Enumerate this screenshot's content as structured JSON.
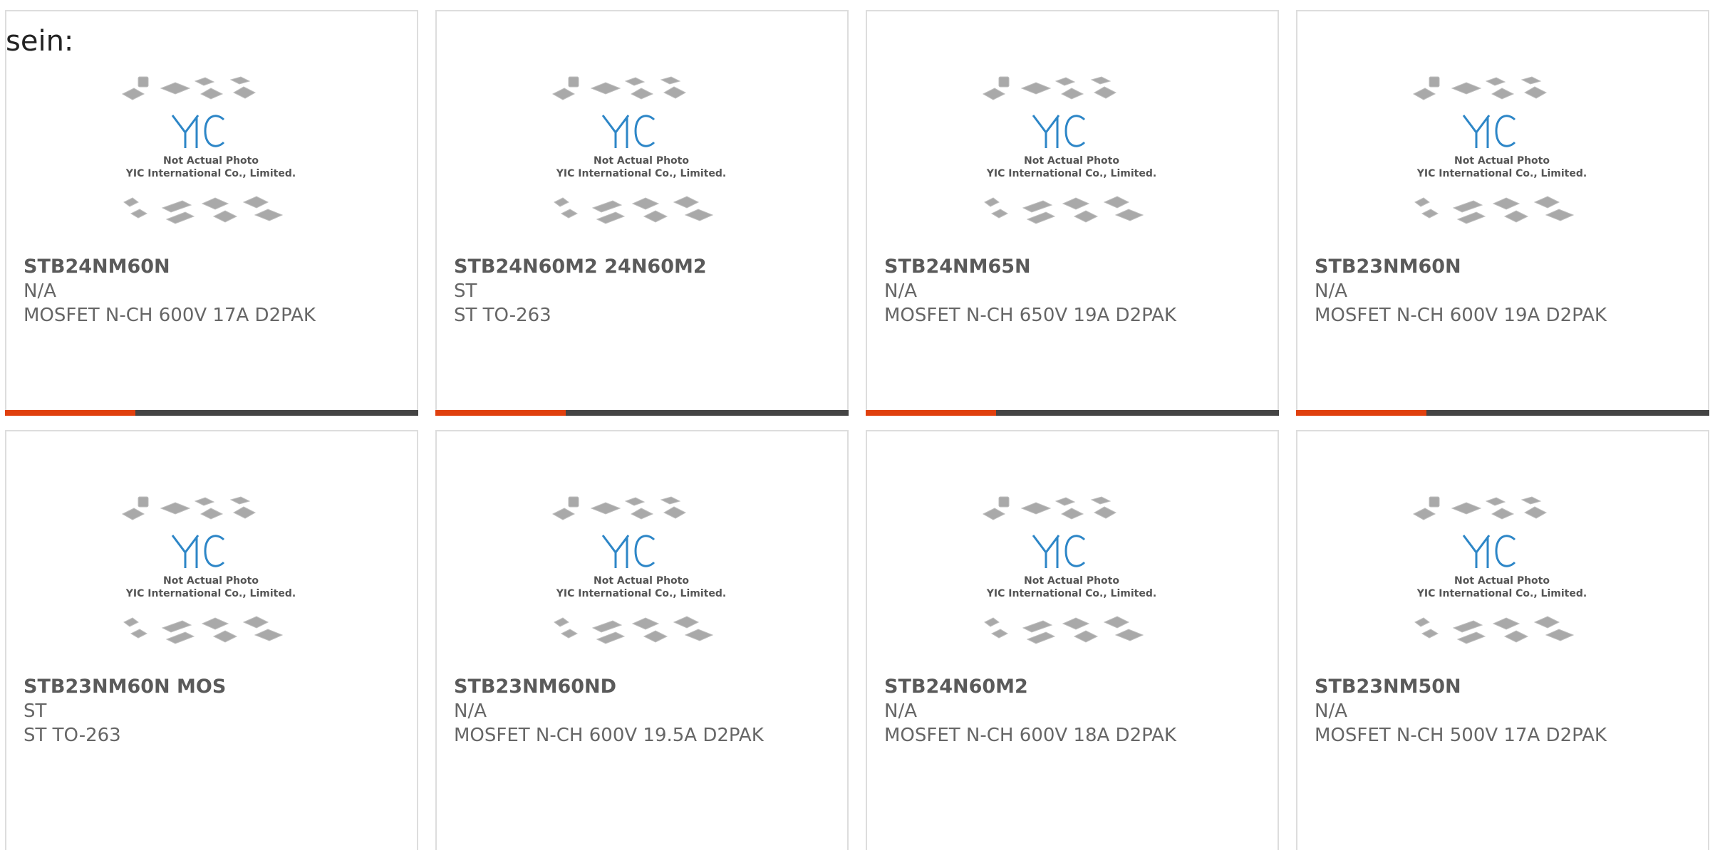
{
  "heading": "sein:",
  "photo_caption": {
    "line1": "Not Actual Photo",
    "line2": "YIC International Co., Limited."
  },
  "colors": {
    "accent_bar": "#e0400e",
    "dark_bar": "#444444",
    "logo_blue": "#2d86c7"
  },
  "products": [
    {
      "name": "STB24NM60N",
      "brand": "N/A",
      "desc": "MOSFET N-CH 600V 17A D2PAK",
      "accent_bar": true
    },
    {
      "name": "STB24N60M2 24N60M2",
      "brand": "ST",
      "desc": "ST TO-263",
      "accent_bar": true
    },
    {
      "name": "STB24NM65N",
      "brand": "N/A",
      "desc": "MOSFET N-CH 650V 19A D2PAK",
      "accent_bar": true
    },
    {
      "name": "STB23NM60N",
      "brand": "N/A",
      "desc": "MOSFET N-CH 600V 19A D2PAK",
      "accent_bar": true
    },
    {
      "name": "STB23NM60N MOS",
      "brand": "ST",
      "desc": "ST TO-263",
      "accent_bar": false
    },
    {
      "name": "STB23NM60ND",
      "brand": "N/A",
      "desc": "MOSFET N-CH 600V 19.5A D2PAK",
      "accent_bar": false
    },
    {
      "name": "STB24N60M2",
      "brand": "N/A",
      "desc": "MOSFET N-CH 600V 18A D2PAK",
      "accent_bar": false
    },
    {
      "name": "STB23NM50N",
      "brand": "N/A",
      "desc": "MOSFET N-CH 500V 17A D2PAK",
      "accent_bar": false
    }
  ]
}
